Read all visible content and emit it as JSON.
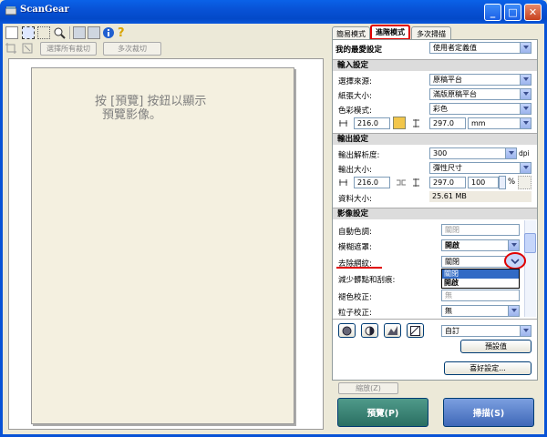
{
  "window": {
    "title": "ScanGear",
    "minimize": "_",
    "maximize": "□",
    "close": "✕"
  },
  "toolbar": {
    "crop_all": "選擇所有裁切",
    "multi_crop": "多次裁切"
  },
  "preview": {
    "message_line1": "按 [預覽] 按鈕以顯示",
    "message_line2": "預覽影像。"
  },
  "tabs": {
    "basic": "簡易模式",
    "advanced": "進階模式",
    "multi": "多次掃描"
  },
  "favorite": {
    "label": "我的最愛設定",
    "value": "使用者定義值"
  },
  "input": {
    "header": "輸入設定",
    "source_label": "選擇來源:",
    "source_value": "原稿平台",
    "paper_label": "紙張大小:",
    "paper_value": "滿版原稿平台",
    "color_label": "色彩模式:",
    "color_value": "彩色",
    "width": "216.0",
    "height": "297.0",
    "unit": "mm"
  },
  "output": {
    "header": "輸出設定",
    "res_label": "輸出解析度:",
    "res_value": "300",
    "res_unit": "dpi",
    "size_label": "輸出大小:",
    "size_value": "彈性尺寸",
    "width": "216.0",
    "height": "297.0",
    "scale": "100",
    "percent": "%",
    "data_label": "資料大小:",
    "data_value": "25.61 MB"
  },
  "image": {
    "header": "影像設定",
    "rows": [
      {
        "label": "自動色調:",
        "value": "關閉"
      },
      {
        "label": "模糊遮罩:",
        "value": "開啟"
      },
      {
        "label": "去除網紋:",
        "value": "關閉"
      },
      {
        "label": "減少髒點和刮痕:",
        "value": ""
      },
      {
        "label": "褪色校正:",
        "value": "無"
      },
      {
        "label": "粒子校正:",
        "value": "無"
      }
    ],
    "dropdown_options": [
      "關閉",
      "開啟"
    ]
  },
  "tone": {
    "preset": "自訂",
    "defaults": "預設值"
  },
  "preferences": "喜好設定...",
  "zoom": "縮放(Z)",
  "actions": {
    "preview": "預覽(P)",
    "scan": "掃描(S)"
  },
  "colors": {
    "highlight": "#e00000",
    "titlebar": "#0852d6",
    "preview_btn": "#2f7a6c",
    "scan_btn": "#4d77c2"
  }
}
